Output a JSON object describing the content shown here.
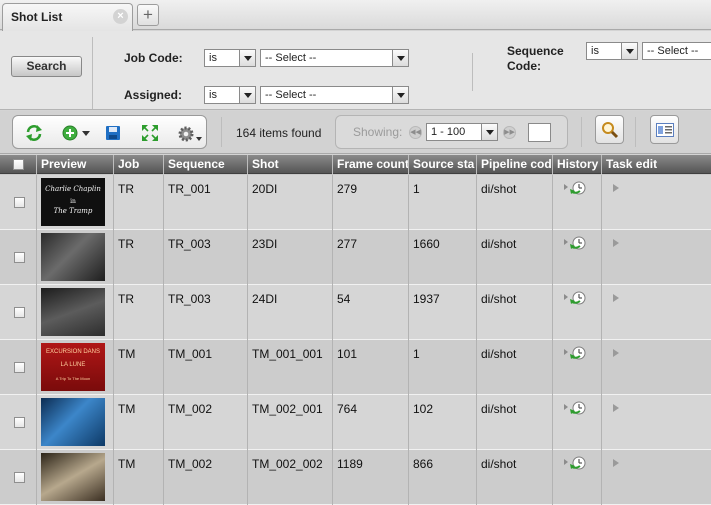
{
  "tab": {
    "label": "Shot List",
    "close_glyph": "×",
    "add_glyph": "+"
  },
  "filters": {
    "search_button": "Search",
    "job_code": {
      "label": "Job Code:",
      "operator": "is",
      "value": "-- Select --"
    },
    "assigned": {
      "label": "Assigned:",
      "operator": "is",
      "value": "-- Select --"
    },
    "sequence_code": {
      "label_line1": "Sequence",
      "label_line2": "Code:",
      "operator": "is",
      "value": "-- Select --"
    }
  },
  "toolbar": {
    "items_found": "164 items found",
    "showing_label": "Showing:",
    "page_range": "1 - 100",
    "page_input": "",
    "icons": [
      "refresh-icon",
      "add-icon",
      "save-icon",
      "expand-icon",
      "gear-icon",
      "magnifier-icon",
      "column-layout-icon"
    ]
  },
  "grid": {
    "columns": [
      "Preview",
      "Job",
      "Sequence",
      "Shot",
      "Frame count",
      "Source sta",
      "Pipeline cod",
      "History",
      "Task edit"
    ],
    "rows": [
      {
        "job": "TR",
        "sequence": "TR_001",
        "shot": "20DI",
        "frame_count": "279",
        "source_start": "1",
        "pipeline_code": "di/shot",
        "thumb": {
          "line1": "Charlie Chaplin",
          "line2": "in",
          "line3": "The Tramp"
        }
      },
      {
        "job": "TR",
        "sequence": "TR_003",
        "shot": "23DI",
        "frame_count": "277",
        "source_start": "1660",
        "pipeline_code": "di/shot",
        "thumb": {
          "line1": "",
          "line2": "",
          "line3": ""
        }
      },
      {
        "job": "TR",
        "sequence": "TR_003",
        "shot": "24DI",
        "frame_count": "54",
        "source_start": "1937",
        "pipeline_code": "di/shot",
        "thumb": {
          "line1": "",
          "line2": "",
          "line3": ""
        }
      },
      {
        "job": "TM",
        "sequence": "TM_001",
        "shot": "TM_001_001",
        "frame_count": "101",
        "source_start": "1",
        "pipeline_code": "di/shot",
        "thumb": {
          "line1": "EXCURSION DANS",
          "line2": "LA LUNE",
          "line3": "A Trip To The Moon"
        }
      },
      {
        "job": "TM",
        "sequence": "TM_002",
        "shot": "TM_002_001",
        "frame_count": "764",
        "source_start": "102",
        "pipeline_code": "di/shot",
        "thumb": {
          "line1": "",
          "line2": "",
          "line3": ""
        }
      },
      {
        "job": "TM",
        "sequence": "TM_002",
        "shot": "TM_002_002",
        "frame_count": "1189",
        "source_start": "866",
        "pipeline_code": "di/shot",
        "thumb": {
          "line1": "",
          "line2": "",
          "line3": ""
        }
      }
    ]
  },
  "colors": {
    "header_bg": "#6b6b6b",
    "accent_green": "#2e9d2e",
    "save_blue": "#1f6fc4"
  }
}
